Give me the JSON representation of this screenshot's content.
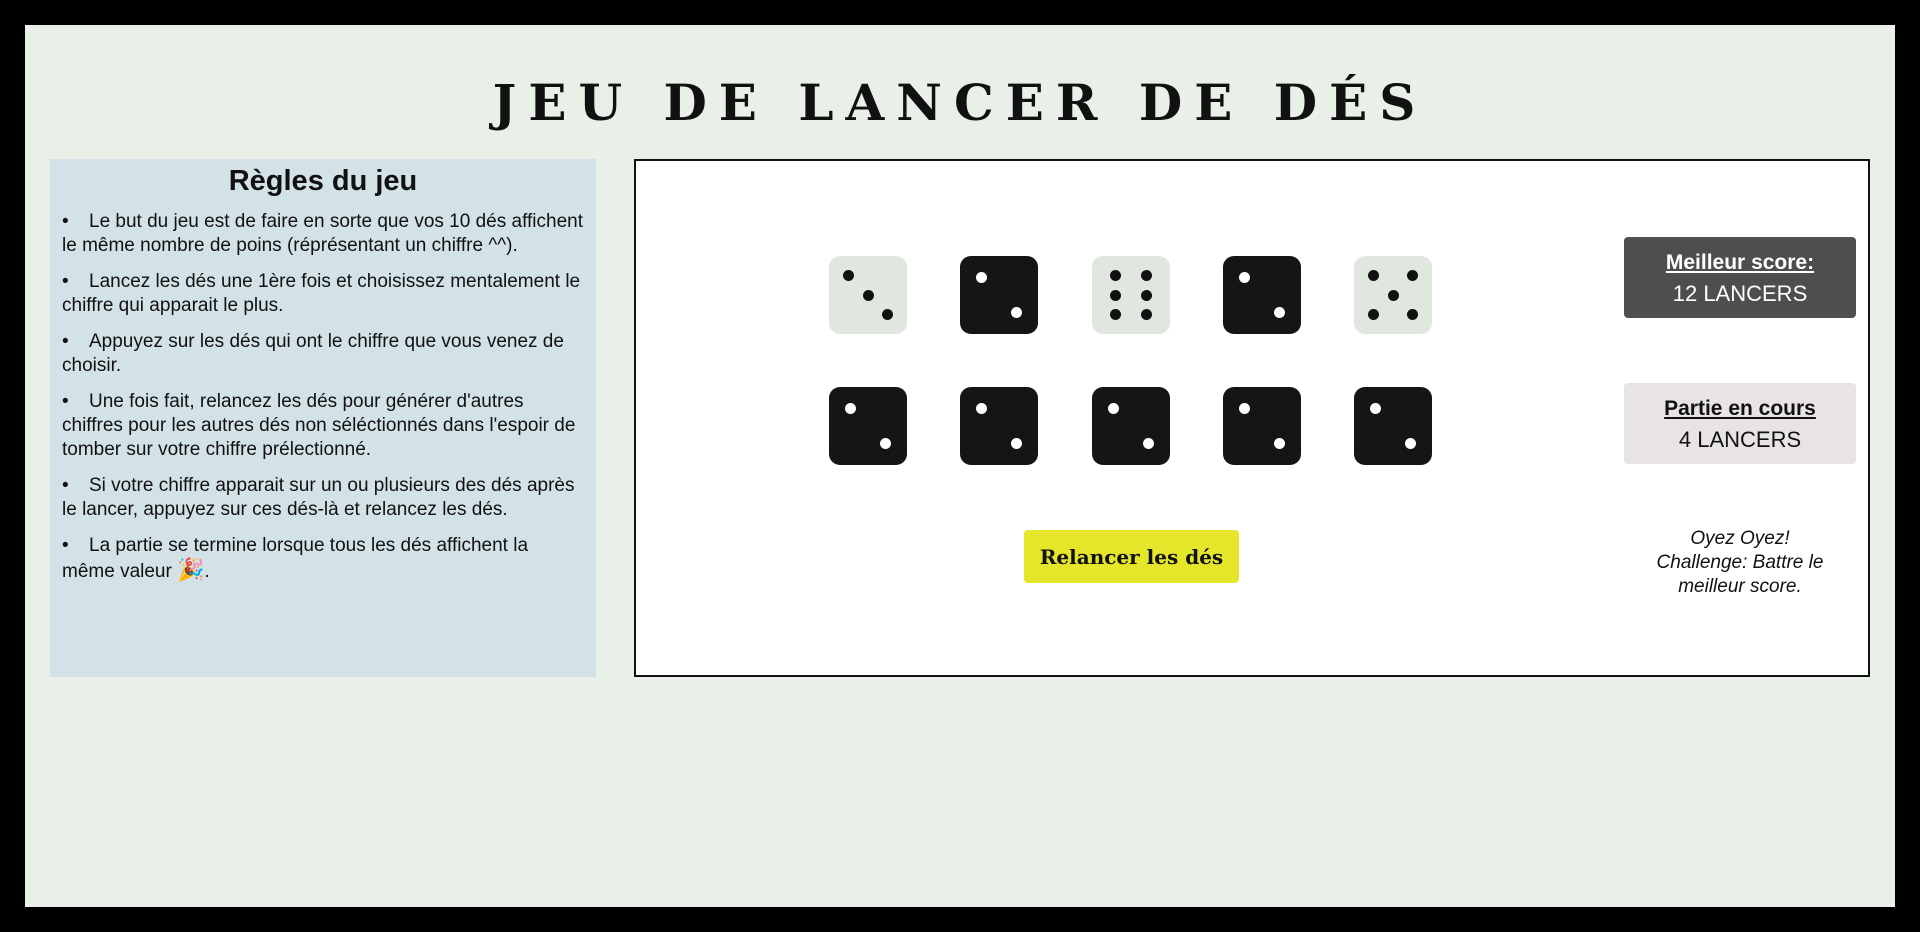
{
  "header": {
    "title": "JEU DE LANCER DE DÉS"
  },
  "rules": {
    "title": "Règles du jeu",
    "items": [
      "Le but du jeu est de faire en sorte que vos 10 dés affichent le même nombre de poins (réprésentant un chiffre ^^).",
      "Lancez les dés une 1ère fois et choisissez mentalement le chiffre qui apparait le plus.",
      "Appuyez sur les dés qui ont le chiffre que vous venez de choisir.",
      "Une fois fait, relancez les dés pour générer d'autres chiffres pour les autres dés non séléctionnés dans l'espoir de tomber sur votre chiffre prélectionné.",
      "Si votre chiffre apparait sur un ou plusieurs des dés après le lancer, appuyez sur ces dés-là et relancez les dés.",
      "La partie se termine lorsque tous les dés affichent la même valeur"
    ],
    "last_item_suffix": ".",
    "party_icon": "party-popper-icon"
  },
  "dice": [
    {
      "value": 3,
      "held": true
    },
    {
      "value": 2,
      "held": false
    },
    {
      "value": 6,
      "held": true
    },
    {
      "value": 2,
      "held": false
    },
    {
      "value": 5,
      "held": true
    },
    {
      "value": 2,
      "held": false
    },
    {
      "value": 2,
      "held": false
    },
    {
      "value": 2,
      "held": false
    },
    {
      "value": 2,
      "held": false
    },
    {
      "value": 2,
      "held": false
    }
  ],
  "controls": {
    "roll_label": "Relancer les dés"
  },
  "scores": {
    "best_label": "Meilleur score:",
    "best_value": "12 LANCERS",
    "current_label": "Partie en cours",
    "current_value": "4 LANCERS",
    "challenge_line1": "Oyez Oyez!",
    "challenge_line2": "Challenge: Battre le meilleur score."
  },
  "colors": {
    "background": "#e8f0e8",
    "rules_panel": "#d3e2e7",
    "die_held": "#dfe7df",
    "die_free": "#151515",
    "roll_button": "#e5e52a",
    "best_box": "#4e4e4e",
    "current_box": "#e8e4e4"
  }
}
